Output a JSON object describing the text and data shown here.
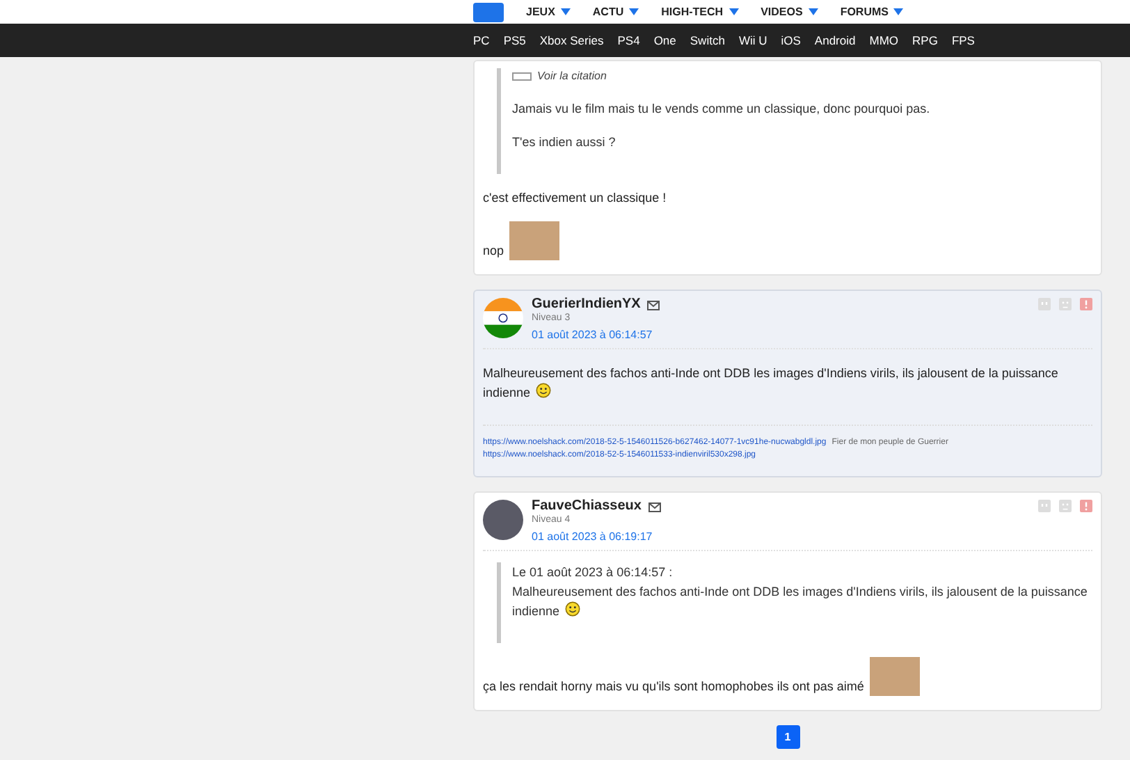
{
  "nav_main": [
    "JEUX",
    "ACTU",
    "HIGH-TECH",
    "VIDEOS",
    "FORUMS"
  ],
  "nav_platforms": [
    "PC",
    "PS5",
    "Xbox Series",
    "PS4",
    "One",
    "Switch",
    "Wii U",
    "iOS",
    "Android",
    "MMO",
    "RPG",
    "FPS"
  ],
  "posts": [
    {
      "highlighted": false,
      "blocks": [
        {
          "kind": "quote",
          "link": "Voir la citation",
          "paragraphs": [
            {
              "text": "Jamais vu le film mais tu le vends comme un classique, donc pourquoi pas.",
              "smiley": false
            },
            {
              "text": "T'es indien aussi ?",
              "smiley": false
            }
          ]
        },
        {
          "kind": "text",
          "text": "c'est effectivement un classique !",
          "image": false,
          "smiley": false
        },
        {
          "kind": "text",
          "text": "nop",
          "image": true,
          "smiley": false
        }
      ]
    },
    {
      "highlighted": true,
      "author": "GuerierIndienYX",
      "level": "Niveau 3",
      "date": "01 août 2023 à 06:14:57",
      "avatar": {
        "kind": "flag"
      },
      "blocks": [
        {
          "kind": "text",
          "text": "Malheureusement des fachos anti-Inde ont DDB les images d'Indiens virils, ils jalousent de la puissance indienne",
          "image": false,
          "smiley": true
        },
        {
          "kind": "links",
          "lines": [
            {
              "url": "https://www.noelshack.com/2018-52-5-1546011526-b627462-14077-1vc91he-nucwabgldl.jpg",
              "note": "Fier de mon peuple de Guerrier"
            },
            {
              "url": "https://www.noelshack.com/2018-52-5-1546011533-indienviril530x298.jpg"
            }
          ]
        }
      ]
    },
    {
      "highlighted": false,
      "author": "FauveChiasseux",
      "level": "Niveau 4",
      "date": "01 août 2023 à 06:19:17",
      "avatar": {
        "kind": "photo"
      },
      "blocks": [
        {
          "kind": "quote",
          "header": "Le 01 août 2023 à 06:14:57 :",
          "paragraphs": [
            {
              "text": "Malheureusement des fachos anti-Inde ont DDB les images d'Indiens virils, ils jalousent de la puissance indienne",
              "smiley": true
            }
          ]
        },
        {
          "kind": "text",
          "text": "ça les rendait horny mais vu qu'ils sont homophobes ils ont pas aimé",
          "image": true,
          "smiley": false
        }
      ]
    }
  ],
  "pagination": [
    {
      "label": "1",
      "selected": true
    }
  ]
}
